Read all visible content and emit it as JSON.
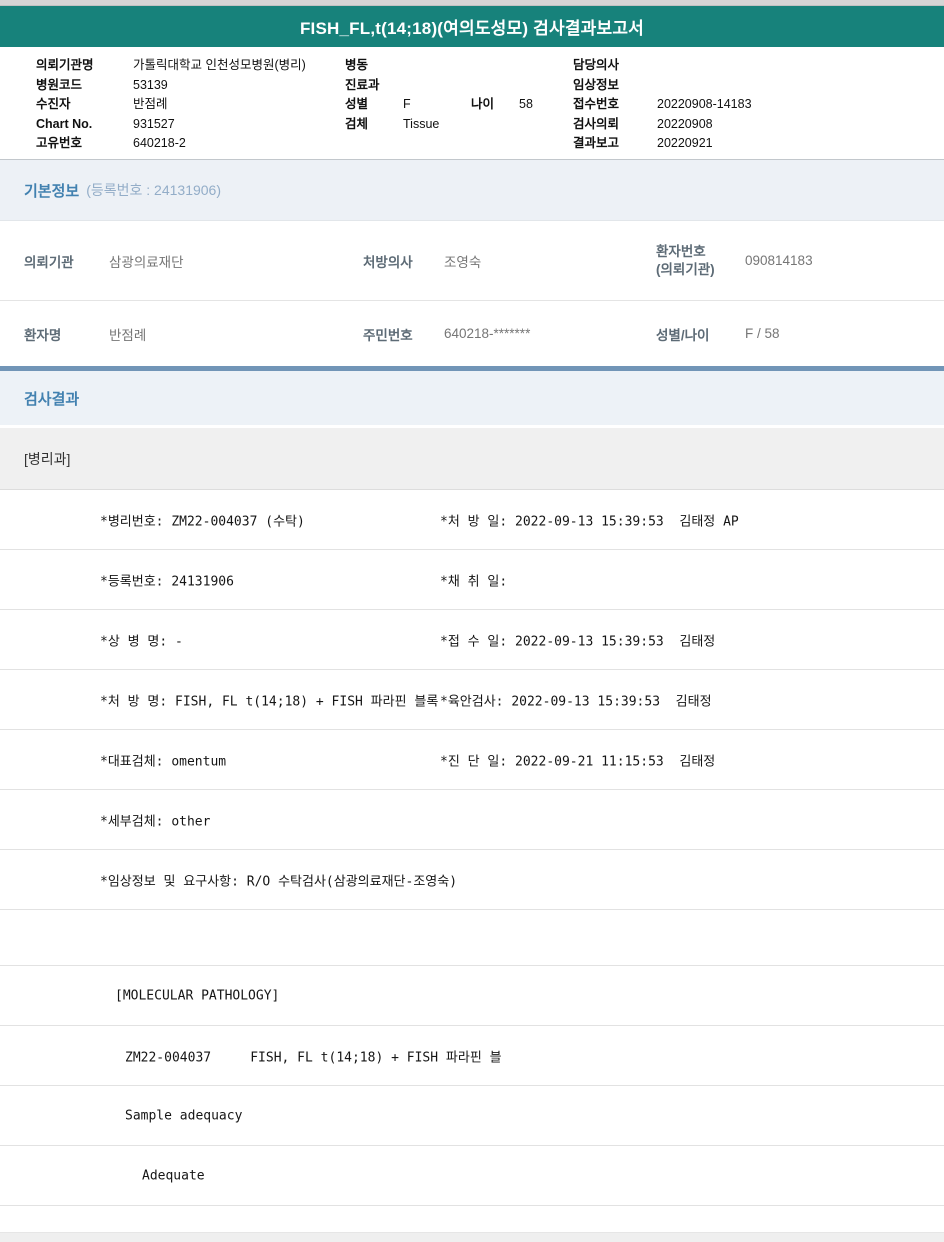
{
  "page": {
    "title": "FISH_FL,t(14;18)(여의도성모) 검사결과보고서"
  },
  "colors": {
    "title_bar_teal": "#17827b",
    "section_title_blue": "#4281b0",
    "results_border_steel_blue": "#7195b7"
  },
  "header": {
    "col1": [
      {
        "label": "의뢰기관명",
        "value": "가톨릭대학교 인천성모병원(병리)"
      },
      {
        "label": "병원코드",
        "value": "53139"
      },
      {
        "label": "수진자",
        "value": "반점례"
      },
      {
        "label": "Chart No.",
        "value": "931527"
      },
      {
        "label": "고유번호",
        "value": "640218-2"
      }
    ],
    "col2": [
      {
        "label": "병동",
        "value": ""
      },
      {
        "label": "진료과",
        "value": ""
      },
      {
        "label": "성별",
        "value": "F"
      },
      {
        "label": "검체",
        "value": "Tissue"
      }
    ],
    "age": {
      "label": "나이",
      "value": "58"
    },
    "col3": [
      {
        "label": "담당의사",
        "value": ""
      },
      {
        "label": "임상정보",
        "value": ""
      },
      {
        "label": "접수번호",
        "value": "20220908-14183"
      },
      {
        "label": "검사의뢰",
        "value": "20220908"
      },
      {
        "label": "결과보고",
        "value": "20220921"
      }
    ]
  },
  "basic_info": {
    "title": "기본정보",
    "subtitle": "(등록번호 : 24131906)",
    "row1": {
      "c1_label": "의뢰기관",
      "c1_value": "삼광의료재단",
      "c2_label": "처방의사",
      "c2_value": "조영숙",
      "c3_label_line1": "환자번호",
      "c3_label_line2": "(의뢰기관)",
      "c3_value": "090814183"
    },
    "row2": {
      "c1_label": "환자명",
      "c1_value": "반점례",
      "c2_label": "주민번호",
      "c2_value": "640218-*******",
      "c3_label": "성별/나이",
      "c3_value": "F / 58"
    }
  },
  "results": {
    "title": "검사결과",
    "department": "[병리과]",
    "rows": [
      {
        "left": "*병리번호: ZM22-004037 (수탁)",
        "right": "*처 방 일: 2022-09-13 15:39:53  김태정 AP"
      },
      {
        "left": "*등록번호: 24131906",
        "right": "*채 취 일:"
      },
      {
        "left": "*상 병 명: -",
        "right": "*접 수 일: 2022-09-13 15:39:53  김태정"
      },
      {
        "left": "*처 방 명: FISH, FL t(14;18) + FISH 파라핀 블록",
        "right": "*육안검사: 2022-09-13 15:39:53  김태정"
      },
      {
        "left": "*대표검체: omentum",
        "right": "*진 단 일: 2022-09-21 11:15:53  김태정"
      },
      {
        "left": "*세부검체: other",
        "right": ""
      },
      {
        "left": "*임상정보 및 요구사항: R/O 수탁검사(삼광의료재단-조영숙)",
        "right": ""
      }
    ],
    "molecular": {
      "section": "[MOLECULAR PATHOLOGY]",
      "order_line": "ZM22-004037     FISH, FL t(14;18) + FISH 파라핀 블",
      "adequacy_label": "Sample adequacy",
      "adequacy_value": "Adequate"
    }
  }
}
